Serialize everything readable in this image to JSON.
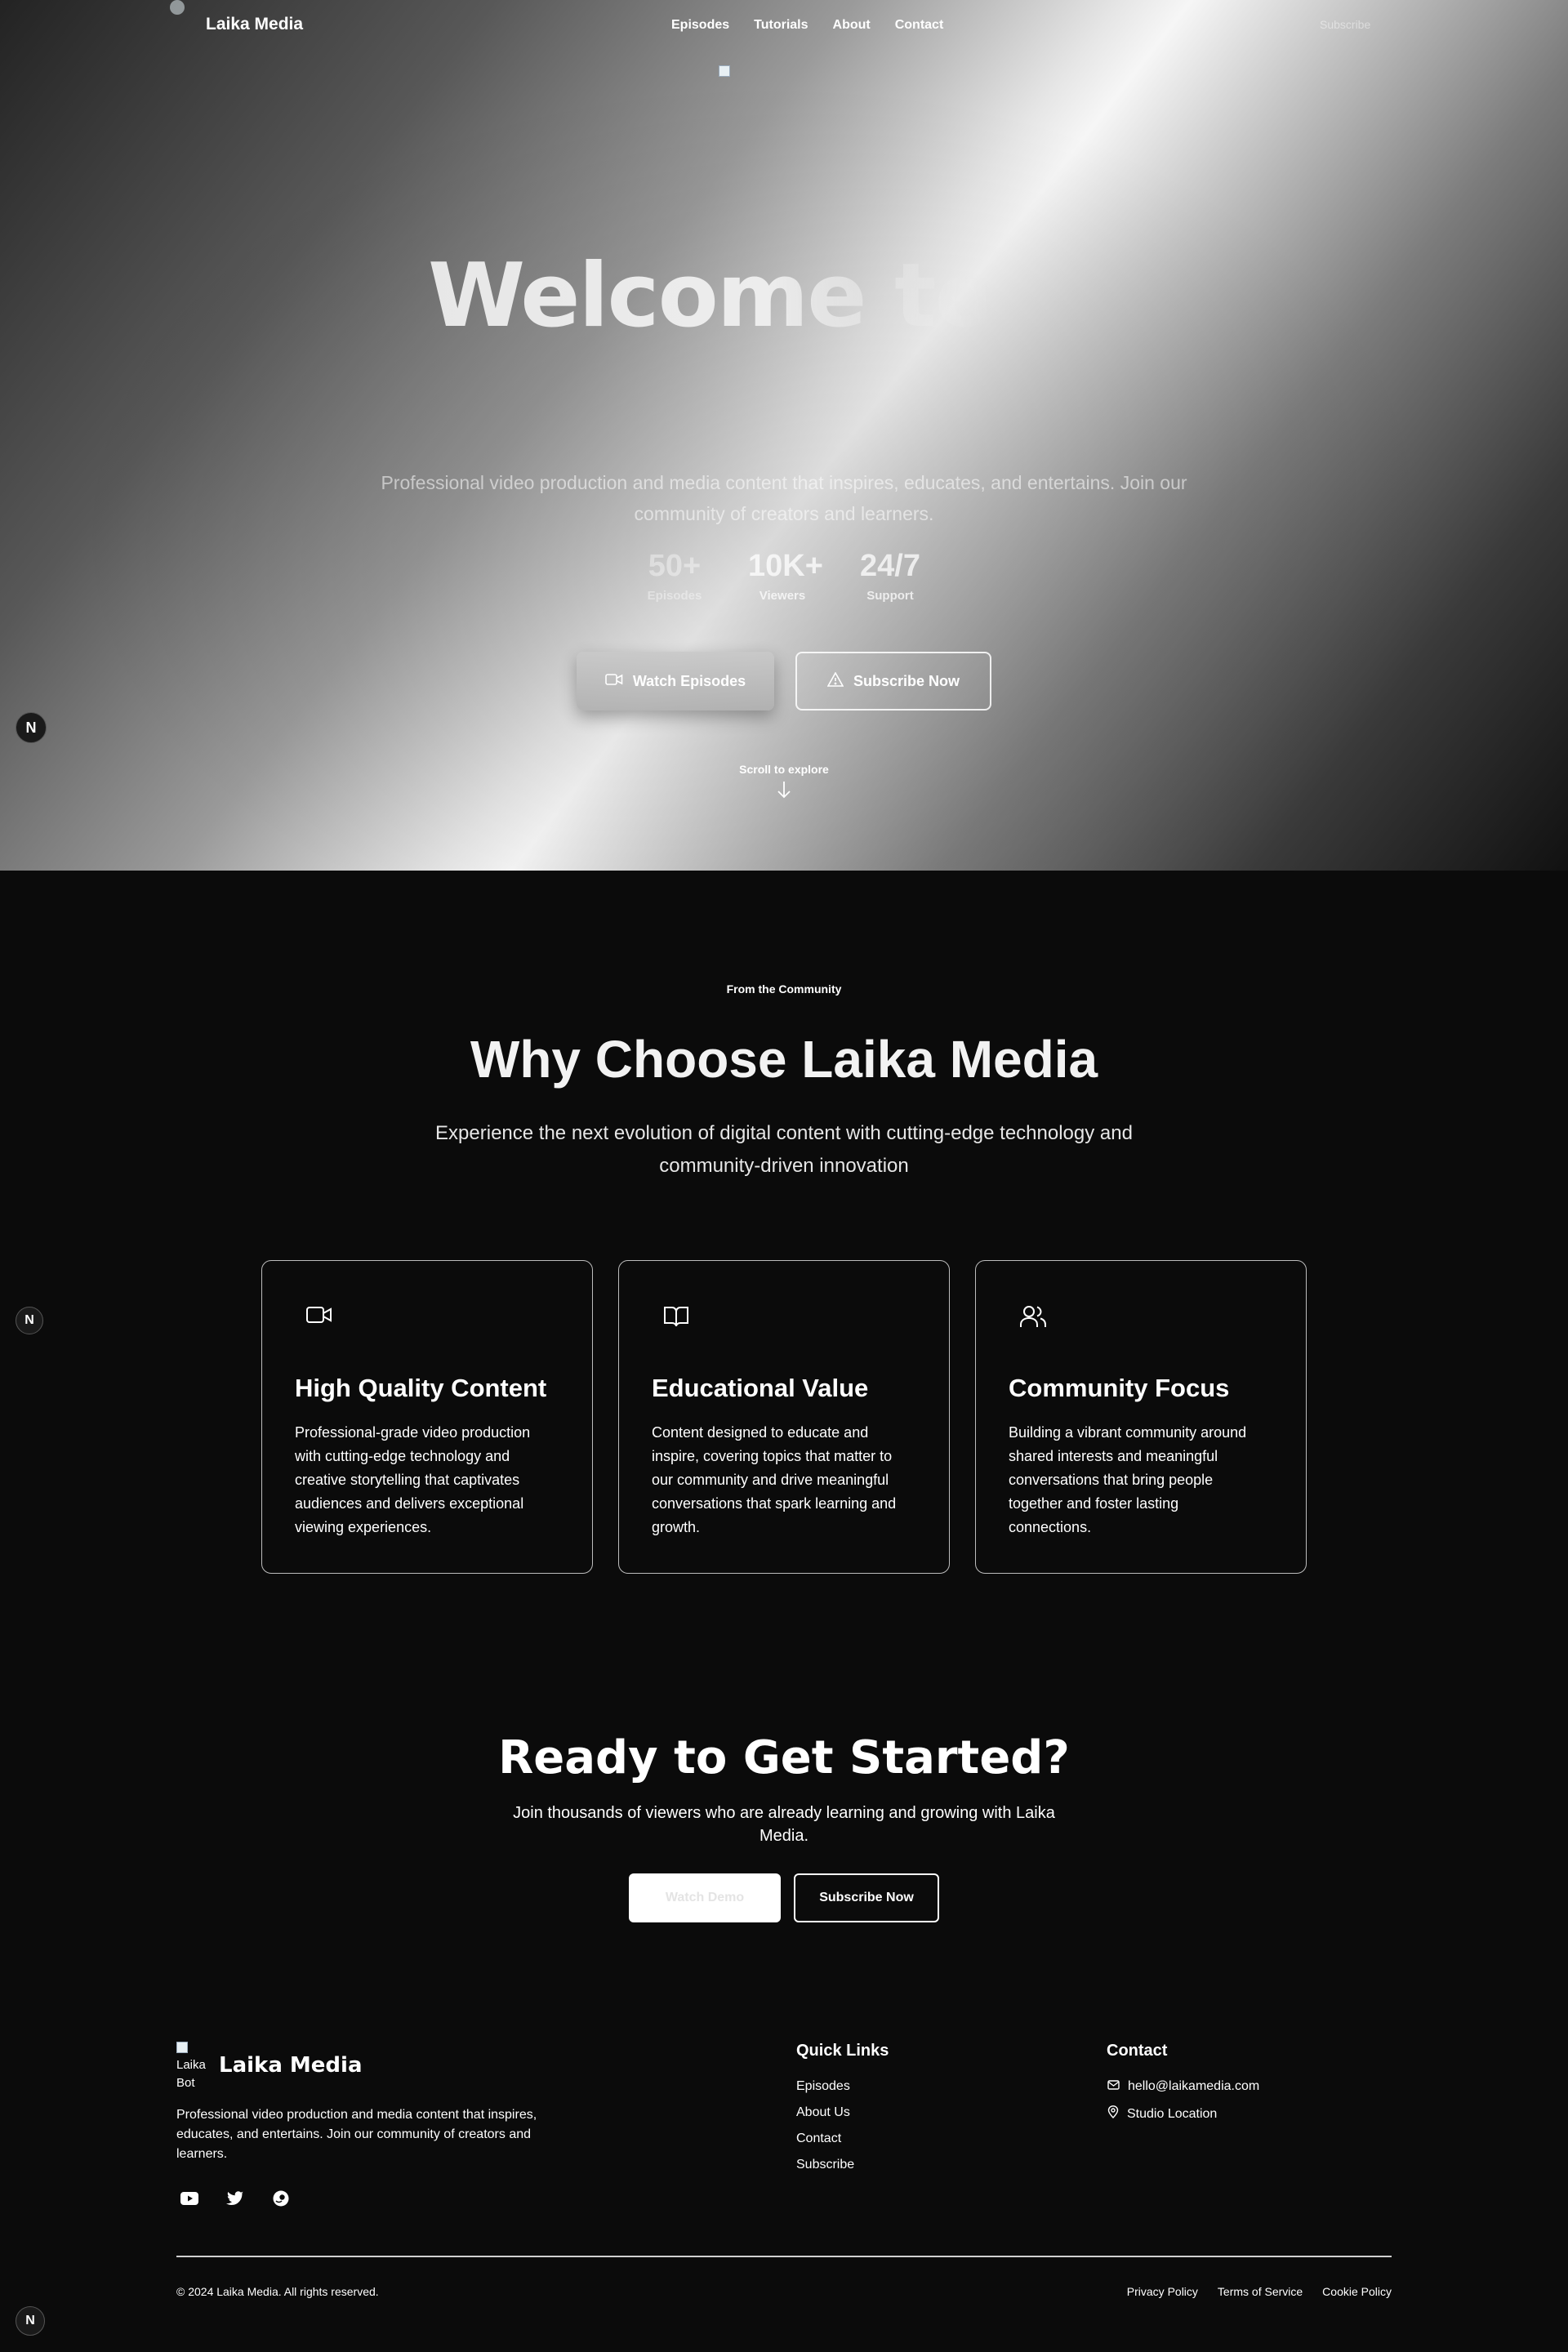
{
  "nav": {
    "brand": "Laika Media",
    "links": [
      "Episodes",
      "Tutorials",
      "About",
      "Contact"
    ],
    "subscribe": "Subscribe"
  },
  "hero": {
    "title": "Welcome to",
    "subtitle": "Professional video production and media content that inspires, educates, and entertains. Join our community of creators and learners.",
    "stats": [
      {
        "value": "50+",
        "label": "Episodes"
      },
      {
        "value": "10K+",
        "label": "Viewers"
      },
      {
        "value": "24/7",
        "label": "Support"
      }
    ],
    "watch_button": "Watch Episodes",
    "subscribe_button": "Subscribe Now",
    "scroll_hint": "Scroll to explore"
  },
  "badge_letter": "N",
  "features": {
    "eyebrow": "From the Community",
    "title": "Why Choose Laika Media",
    "subtitle": "Experience the next evolution of digital content with cutting-edge technology and community-driven innovation",
    "cards": [
      {
        "icon": "video-icon",
        "title": "High Quality Content",
        "text": "Professional-grade video production with cutting-edge technology and creative storytelling that captivates audiences and delivers exceptional viewing experiences."
      },
      {
        "icon": "book-icon",
        "title": "Educational Value",
        "text": "Content designed to educate and inspire, covering topics that matter to our community and drive meaningful conversations that spark learning and growth."
      },
      {
        "icon": "users-icon",
        "title": "Community Focus",
        "text": "Building a vibrant community around shared interests and meaningful conversations that bring people together and foster lasting connections."
      }
    ]
  },
  "cta": {
    "title": "Ready to Get Started?",
    "subtitle": "Join thousands of viewers who are already learning and growing with Laika Media.",
    "demo_button": "Watch Demo",
    "subscribe_button": "Subscribe Now"
  },
  "footer": {
    "logo_alt": "Laika Bot",
    "brand": "Laika Media",
    "description": "Professional video production and media content that inspires, educates, and entertains. Join our community of creators and learners.",
    "socials": [
      "youtube-icon",
      "twitter-icon",
      "discord-icon"
    ],
    "quick_links_title": "Quick Links",
    "quick_links": [
      "Episodes",
      "About Us",
      "Contact",
      "Subscribe"
    ],
    "contact_title": "Contact",
    "email": "hello@laikamedia.com",
    "location": "Studio Location",
    "copyright": "© 2024 Laika Media. All rights reserved.",
    "legal": [
      "Privacy Policy",
      "Terms of Service",
      "Cookie Policy"
    ]
  },
  "colors": {
    "background": "#0b0b0b",
    "text": "#ffffff",
    "card_border": "#bdbdbd"
  }
}
